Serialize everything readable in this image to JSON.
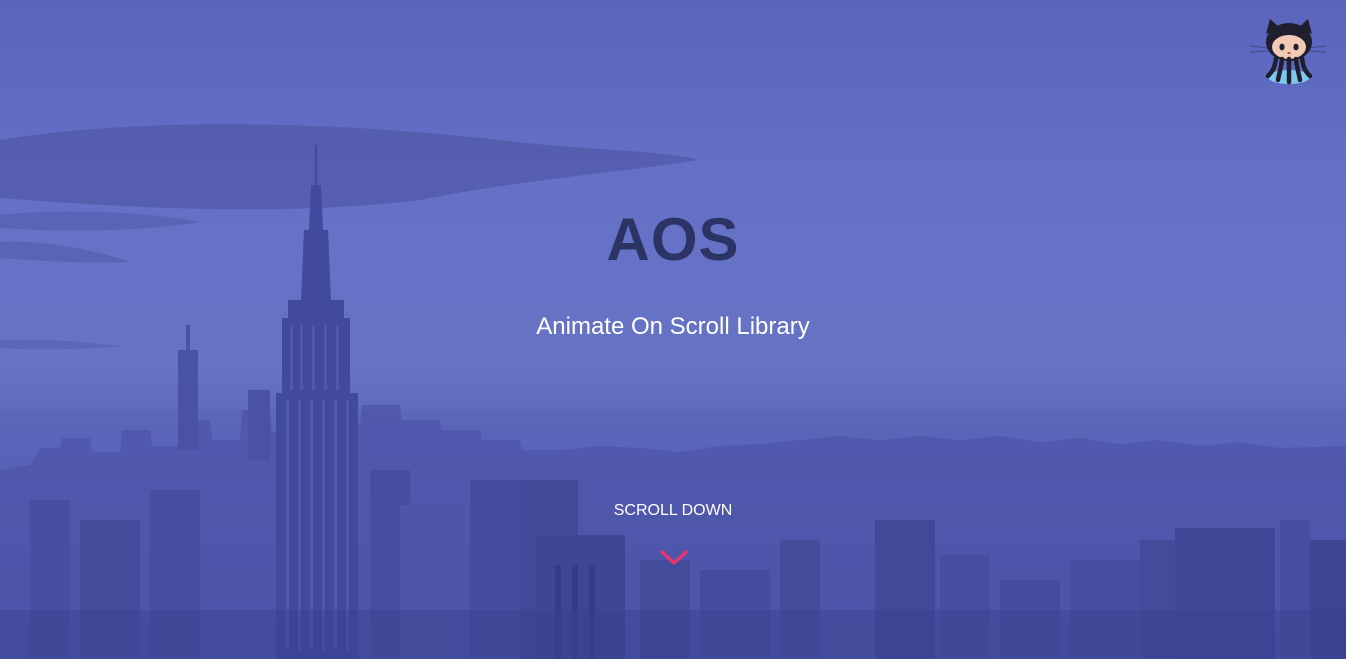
{
  "hero": {
    "title": "AOS",
    "subtitle": "Animate On Scroll Library",
    "scroll_label": "SCROLL DOWN",
    "scroll_icon": "chevron-down-icon",
    "github_icon": "octocat-icon"
  },
  "colors": {
    "overlay": "#6471c6",
    "title": "#2c3466",
    "text": "#ffffff",
    "accent": "#e8356d"
  }
}
